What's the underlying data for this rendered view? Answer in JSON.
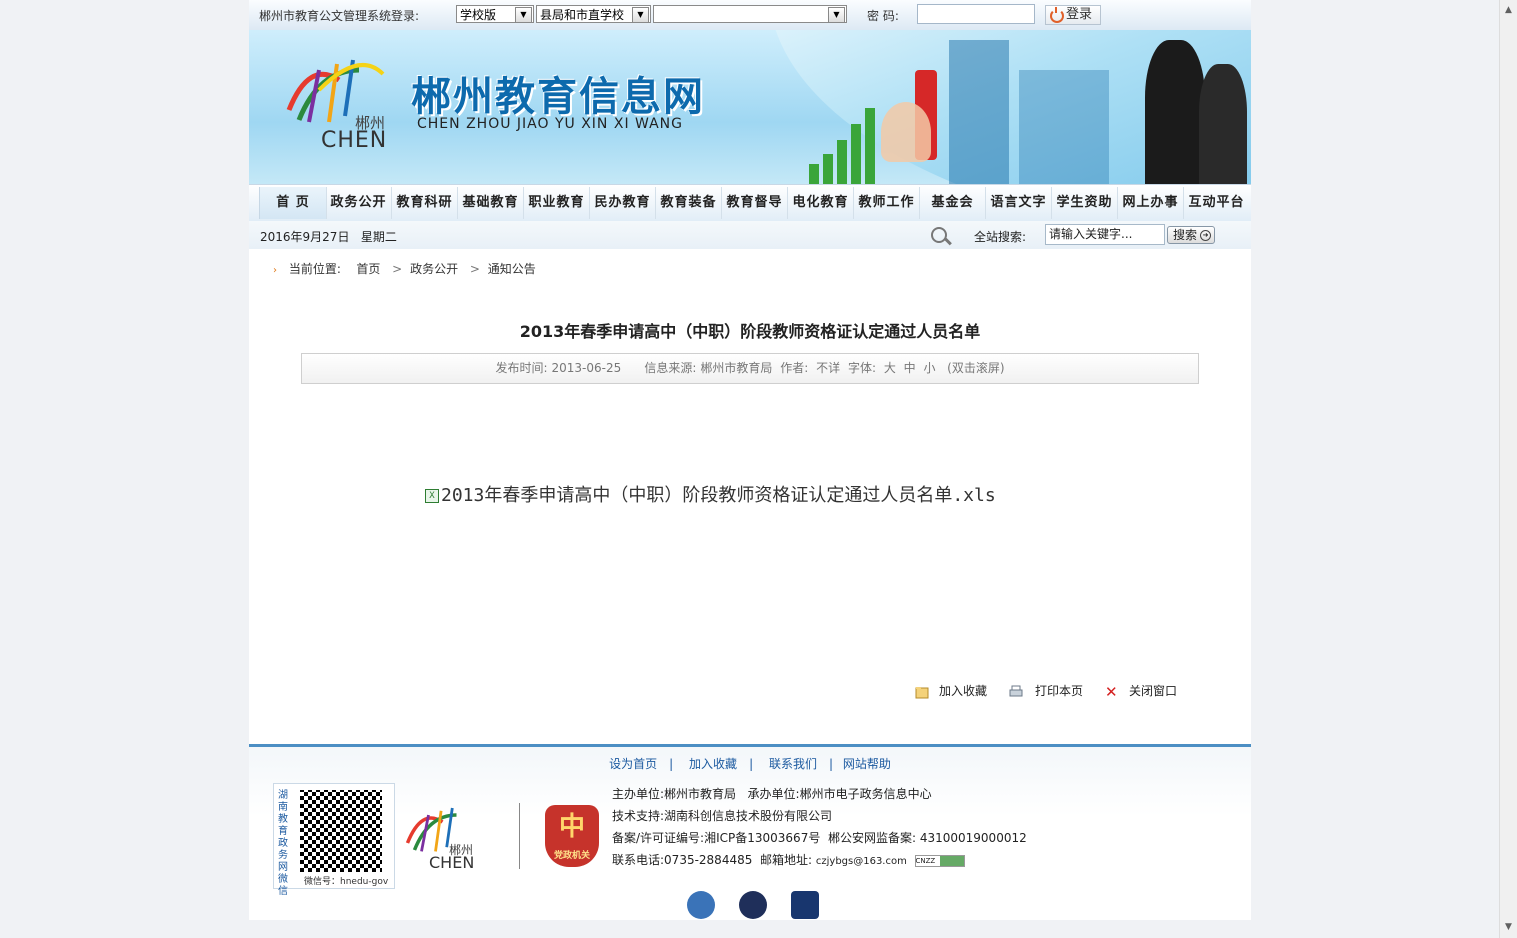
{
  "login": {
    "label": "郴州市教育公文管理系统登录:",
    "type_select": "学校版",
    "unit_select": "县局和市直学校",
    "school_select": "",
    "password_label": "密 码:",
    "login_button": "登录"
  },
  "banner": {
    "title": "郴州教育信息网",
    "subtitle": "CHEN ZHOU JIAO YU XIN XI WANG",
    "logo_cn": "郴州",
    "logo_en": "CHEN"
  },
  "nav": [
    "首 页",
    "政务公开",
    "教育科研",
    "基础教育",
    "职业教育",
    "民办教育",
    "教育装备",
    "教育督导",
    "电化教育",
    "教师工作",
    "基金会",
    "语言文字",
    "学生资助",
    "网上办事",
    "互动平台"
  ],
  "subbar": {
    "date": "2016年9月27日",
    "weekday": "星期二",
    "search_label": "全站搜索:",
    "search_placeholder": "请输入关键字...",
    "search_button": "搜索"
  },
  "breadcrumb": {
    "label": "当前位置:",
    "items": [
      "首页",
      "政务公开",
      "通知公告"
    ]
  },
  "article": {
    "title": "2013年春季申请高中（中职）阶段教师资格证认定通过人员名单",
    "publish_label": "发布时间:",
    "publish_date": "2013-06-25",
    "source_label": "信息来源:",
    "source": "郴州市教育局",
    "author_label": "作者:",
    "author": "不详",
    "font_label": "字体:",
    "font_large": "大",
    "font_medium": "中",
    "font_small": "小",
    "scroll_hint": "(双击滚屏)",
    "attachment": "2013年春季申请高中（中职）阶段教师资格证认定通过人员名单.xls"
  },
  "actions": {
    "favorite": "加入收藏",
    "print": "打印本页",
    "close": "关闭窗口"
  },
  "footer": {
    "links": [
      "设为首页",
      "加入收藏",
      "联系我们",
      "网站帮助"
    ],
    "qr_vertical": "湖南教育政务网微信",
    "wechat_id": "微信号：hnedu-gov",
    "logo_cn": "郴州",
    "logo_en": "CHEN",
    "badge_text": "党政机关",
    "host_label": "主办单位:",
    "host": "郴州市教育局",
    "organizer_label": "承办单位:",
    "organizer": "郴州市电子政务信息中心",
    "tech_label": "技术支持:",
    "tech": "湖南科创信息技术股份有限公司",
    "icp_label": "备案/许可证编号:",
    "icp": "湘ICP备13003667号",
    "police_label": "郴公安网监备案:",
    "police": "43100019000012",
    "phone_label": "联系电话:",
    "phone": "0735-2884485",
    "email_label": "邮箱地址:",
    "email": "czjybgs@163.com",
    "cnzz": "CNZZ"
  },
  "colors": {
    "title_blue": "#0d6aad",
    "footer_line": "#4c8fc4",
    "link_blue": "#1c5aa0",
    "badge_red": "#c6332b"
  }
}
